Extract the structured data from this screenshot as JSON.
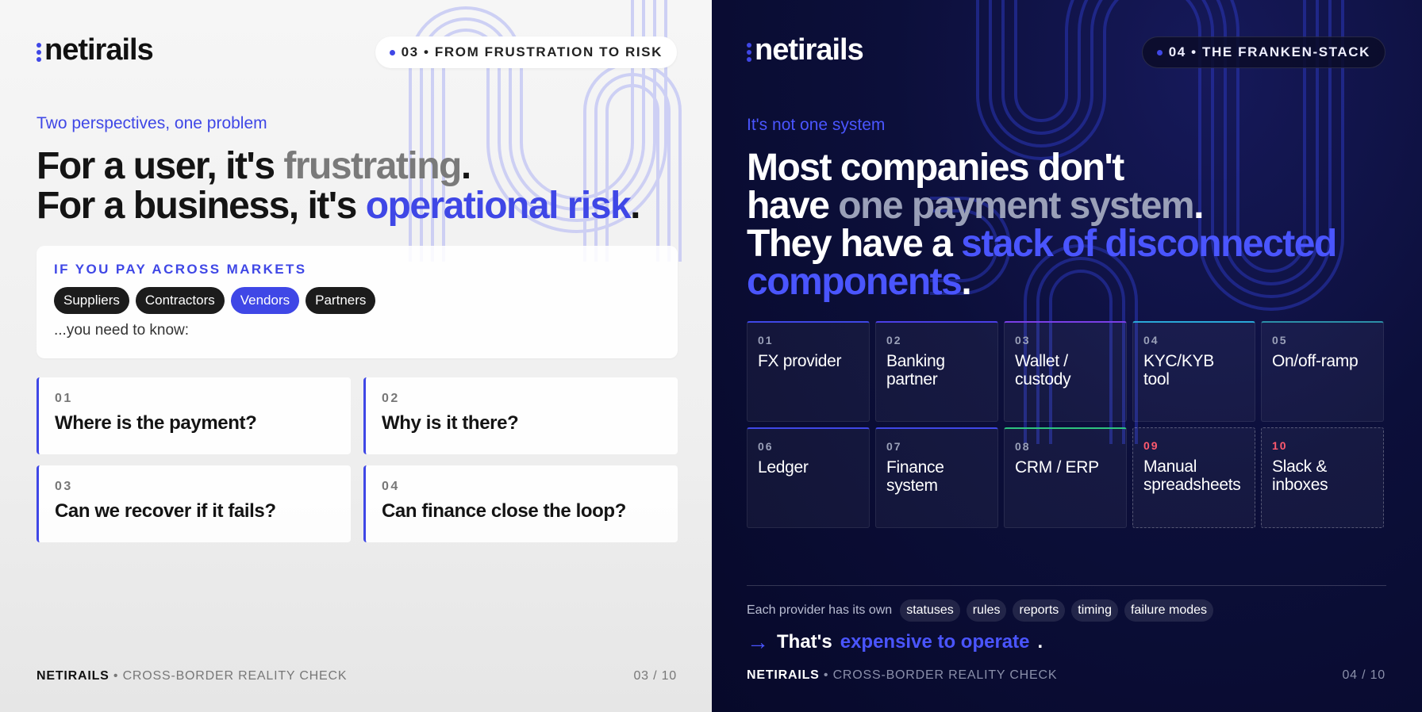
{
  "left": {
    "logo_text": "netirails",
    "tag": "03 • FROM FRUSTRATION TO RISK",
    "eyebrow": "Two perspectives, one problem",
    "headline": {
      "line1_a": "For a user, it's ",
      "line1_b": "frustrating",
      "line1_c": ".",
      "line2_a": "For a business, it's ",
      "line2_b": "operational risk",
      "line2_c": "."
    },
    "market_card": {
      "title": "IF YOU PAY ACROSS MARKETS",
      "chips": [
        "Suppliers",
        "Contractors",
        "Vendors",
        "Partners"
      ],
      "active_chip": "Vendors",
      "note": "...you need to know:"
    },
    "questions": [
      {
        "num": "01",
        "text": "Where is the payment?"
      },
      {
        "num": "02",
        "text": "Why is it there?"
      },
      {
        "num": "03",
        "text": "Can we recover if it fails?"
      },
      {
        "num": "04",
        "text": "Can finance close the loop?"
      }
    ],
    "footer": {
      "brand": "NETIRAILS",
      "sep": " • ",
      "title": "CROSS-BORDER REALITY CHECK",
      "page": "03 / 10"
    }
  },
  "right": {
    "logo_text": "netirails",
    "tag": "04 • THE FRANKEN-STACK",
    "eyebrow": "It's not one system",
    "headline": {
      "line1": "Most companies don't",
      "line2_a": "have ",
      "line2_b": "one payment system",
      "line2_c": ".",
      "line3_a": "They have a ",
      "line3_b": "stack of disconnected",
      "line4_b": "components",
      "line4_c": "."
    },
    "components": [
      {
        "num": "01",
        "label": "FX provider",
        "accent": "#3f47e6",
        "dashed": false,
        "red": false
      },
      {
        "num": "02",
        "label": "Banking partner",
        "accent": "#4b3fe6",
        "dashed": false,
        "red": false
      },
      {
        "num": "03",
        "label": "Wallet / custody",
        "accent": "#7a3fe6",
        "dashed": false,
        "red": false
      },
      {
        "num": "04",
        "label": "KYC/KYB tool",
        "accent": "#2aa8d8",
        "dashed": false,
        "red": false
      },
      {
        "num": "05",
        "label": "On/off-ramp",
        "accent": "#2c8fa8",
        "dashed": false,
        "red": false
      },
      {
        "num": "06",
        "label": "Ledger",
        "accent": "#3f47e6",
        "dashed": false,
        "red": false
      },
      {
        "num": "07",
        "label": "Finance system",
        "accent": "#3f47e6",
        "dashed": false,
        "red": false
      },
      {
        "num": "08",
        "label": "CRM / ERP",
        "accent": "#2ec27e",
        "dashed": false,
        "red": false
      },
      {
        "num": "09",
        "label": "Manual spreadsheets",
        "accent": "",
        "dashed": true,
        "red": true
      },
      {
        "num": "10",
        "label": "Slack & inboxes",
        "accent": "",
        "dashed": true,
        "red": true
      }
    ],
    "provider_text": "Each provider has its own",
    "provider_tags": [
      "statuses",
      "rules",
      "reports",
      "timing",
      "failure modes"
    ],
    "punchline": {
      "arrow": "→",
      "a": "That's",
      "b": "expensive to operate",
      "c": "."
    },
    "footer": {
      "brand": "NETIRAILS",
      "sep": " • ",
      "title": "CROSS-BORDER REALITY CHECK",
      "page": "04 / 10"
    }
  },
  "colors": {
    "accent": "#3f47e6",
    "accent_bright": "#4a55ff",
    "alert": "#ff5a6e"
  }
}
